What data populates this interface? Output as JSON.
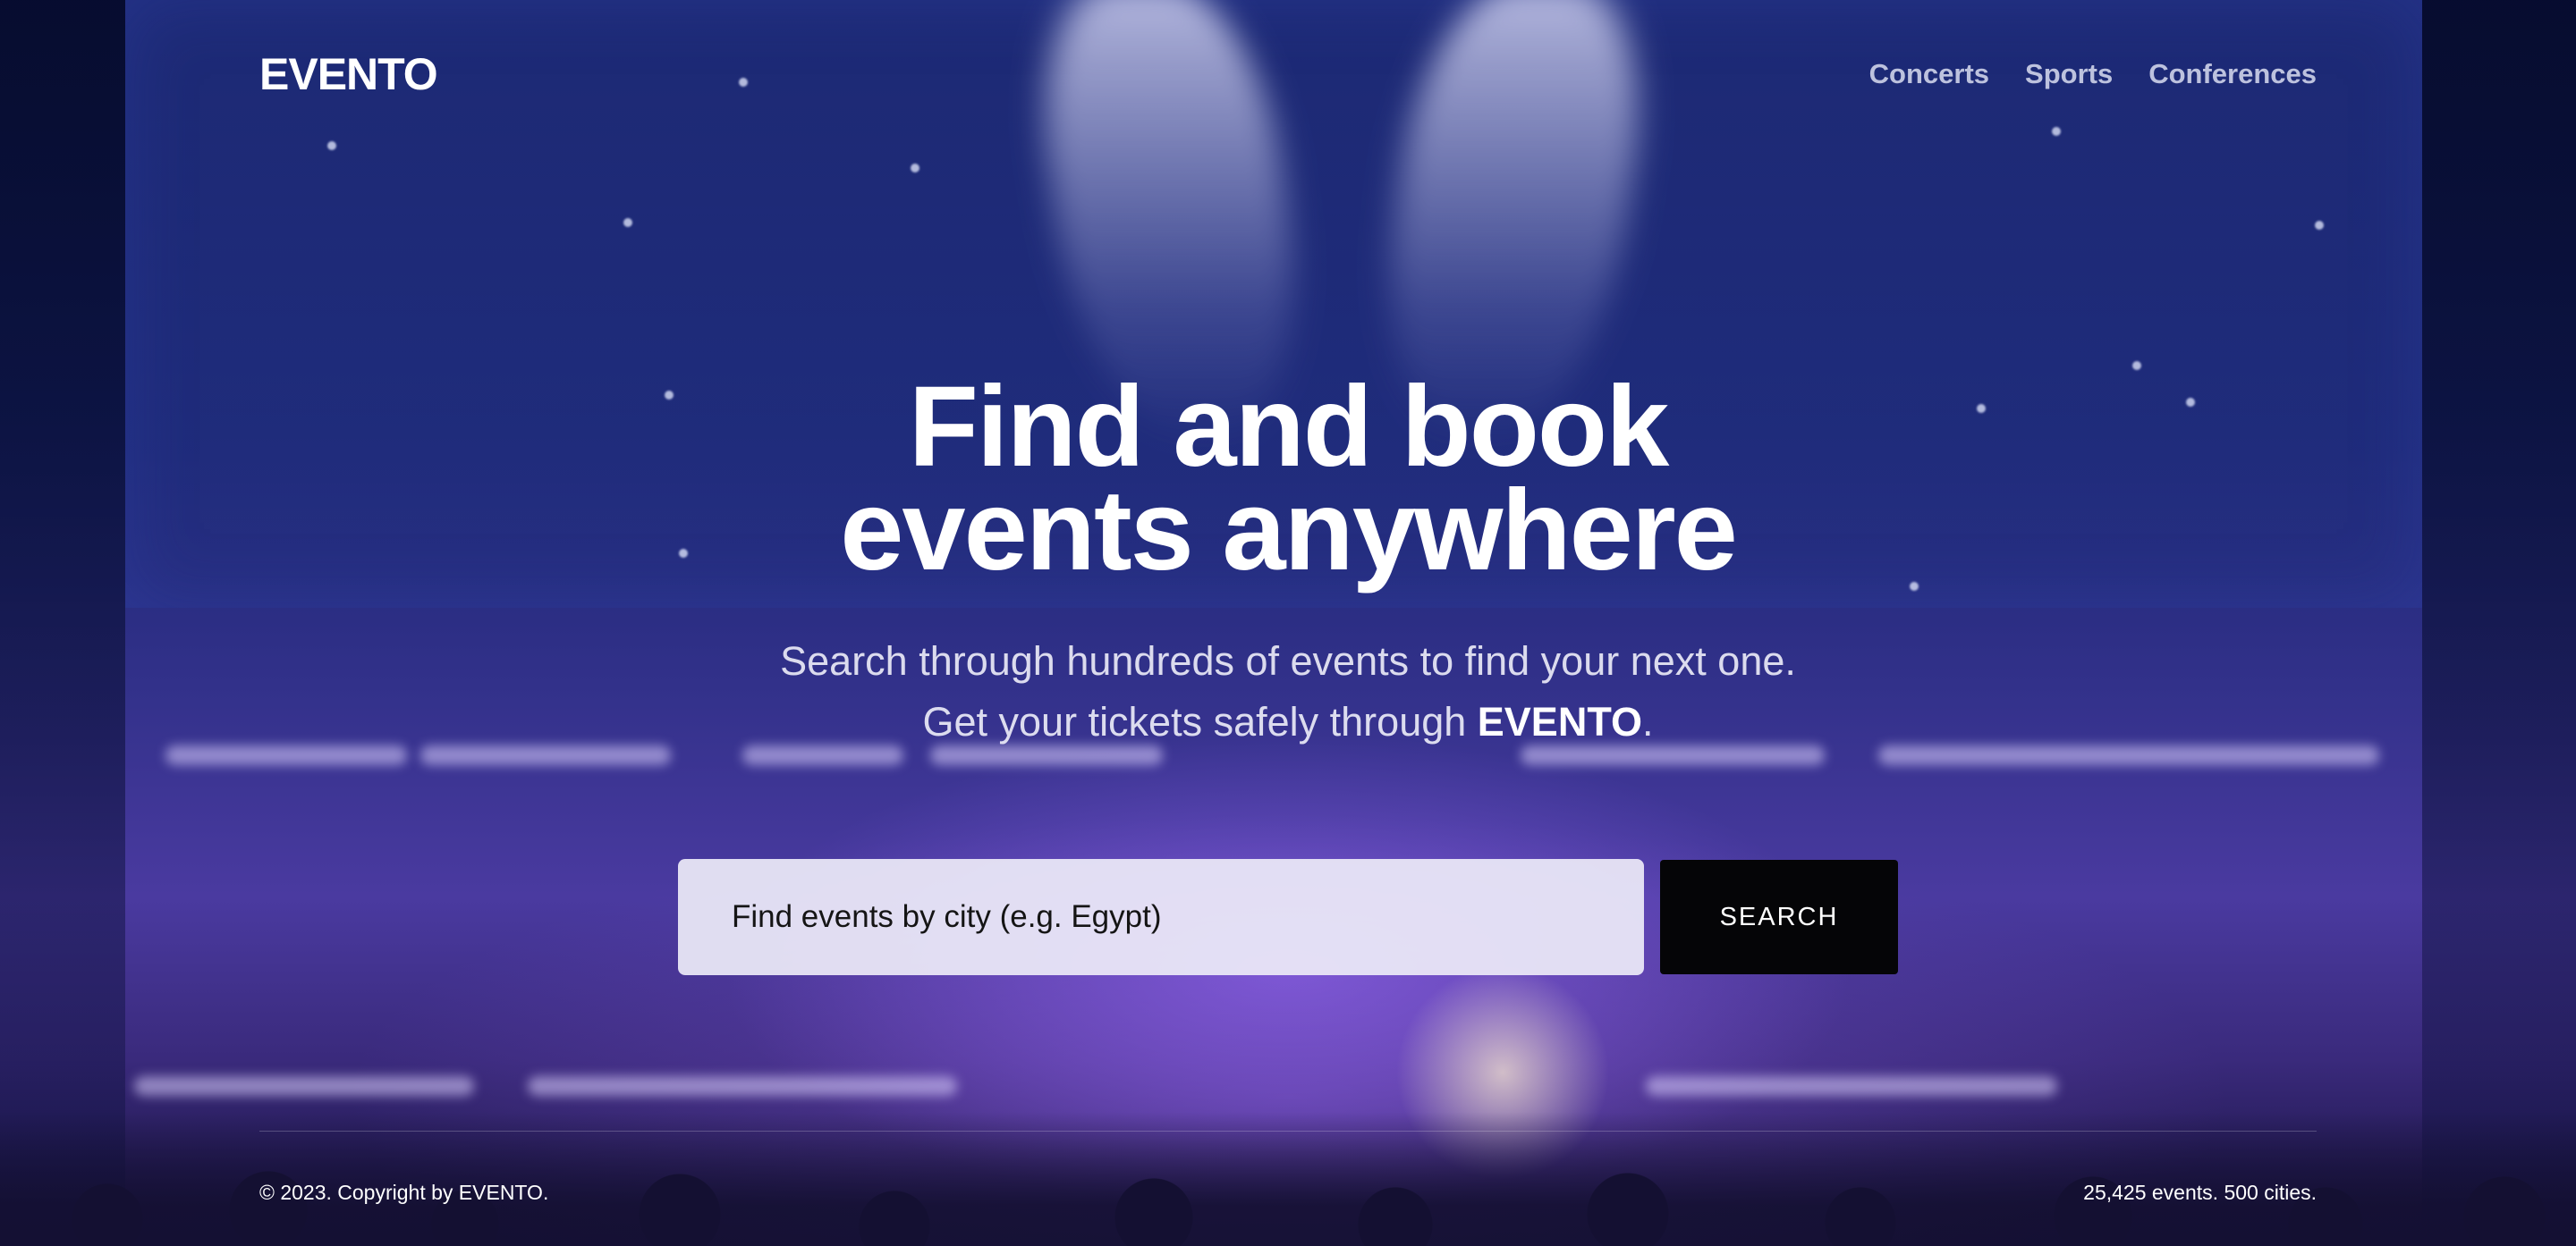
{
  "header": {
    "logo": "EVENTO",
    "nav": [
      "Concerts",
      "Sports",
      "Conferences"
    ]
  },
  "hero": {
    "headline_line1": "Find and book",
    "headline_line2": "events anywhere",
    "subline_line1": "Search through hundreds of events to find your next one.",
    "subline_line2_prefix": "Get your tickets safely through ",
    "subline_brand": "EVENTO",
    "subline_line2_suffix": "."
  },
  "search": {
    "placeholder": "Find events by city (e.g. Egypt)",
    "button_label": "SEARCH"
  },
  "footer": {
    "copyright": "© 2023. Copyright by EVENTO.",
    "stats": "25,425 events. 500 cities."
  },
  "colors": {
    "background": "#1b2674",
    "button": "#050507",
    "input": "#eceaf8"
  }
}
